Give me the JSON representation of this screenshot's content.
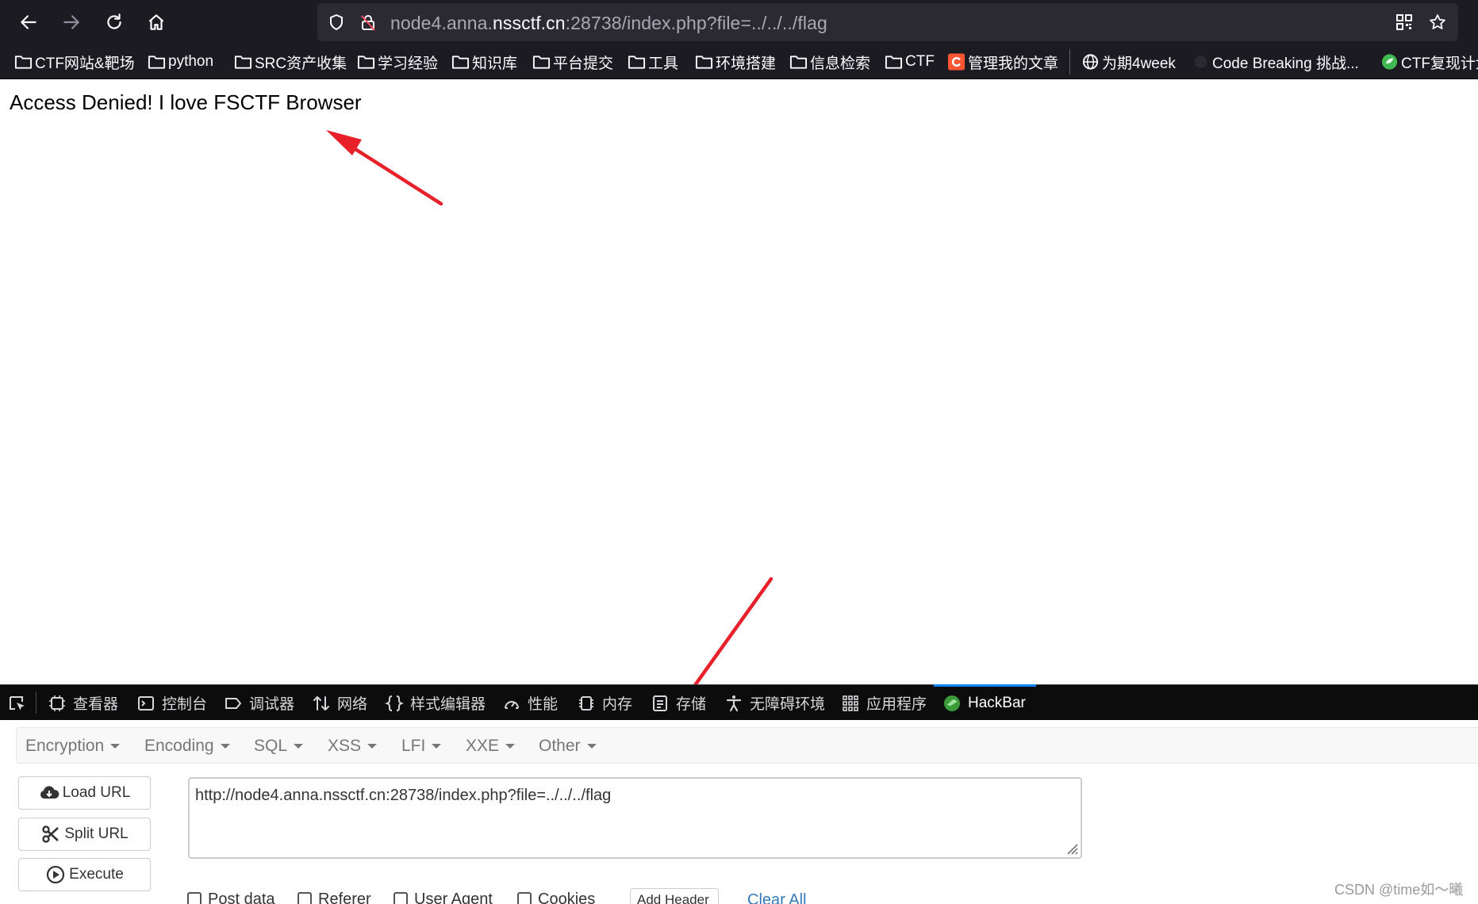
{
  "browser": {
    "url_prefix": "node4.anna.",
    "url_domain": "nssctf.cn",
    "url_suffix": ":28738/index.php?file=../../../flag"
  },
  "bookmarks": [
    {
      "label": "CTF网站&靶场",
      "icon": "folder-icon"
    },
    {
      "label": "python",
      "icon": "folder-icon"
    },
    {
      "label": "SRC资产收集",
      "icon": "folder-icon"
    },
    {
      "label": "学习经验",
      "icon": "folder-icon"
    },
    {
      "label": "知识库",
      "icon": "folder-icon"
    },
    {
      "label": "平台提交",
      "icon": "folder-icon"
    },
    {
      "label": "工具",
      "icon": "folder-icon"
    },
    {
      "label": "环境搭建",
      "icon": "folder-icon"
    },
    {
      "label": "信息检索",
      "icon": "folder-icon"
    },
    {
      "label": "CTF",
      "icon": "folder-icon"
    },
    {
      "label": "管理我的文章",
      "icon": "csdn-logo-icon"
    },
    {
      "label": "为期4week",
      "icon": "globe-icon"
    },
    {
      "label": "Code Breaking 挑战...",
      "icon": "site-icon"
    },
    {
      "label": "CTF复现计划",
      "icon": "green-site-icon"
    }
  ],
  "page": {
    "message": "Access Denied! I love FSCTF Browser"
  },
  "devtools": {
    "tabs": [
      {
        "label": "查看器",
        "icon": "inspector-icon"
      },
      {
        "label": "控制台",
        "icon": "console-icon"
      },
      {
        "label": "调试器",
        "icon": "debugger-icon"
      },
      {
        "label": "网络",
        "icon": "network-icon"
      },
      {
        "label": "样式编辑器",
        "icon": "style-editor-icon"
      },
      {
        "label": "性能",
        "icon": "performance-icon"
      },
      {
        "label": "内存",
        "icon": "memory-icon"
      },
      {
        "label": "存储",
        "icon": "storage-icon"
      },
      {
        "label": "无障碍环境",
        "icon": "accessibility-icon"
      },
      {
        "label": "应用程序",
        "icon": "application-icon"
      },
      {
        "label": "HackBar",
        "icon": "hackbar-icon",
        "active": true
      }
    ]
  },
  "hackbar": {
    "menu": [
      "Encryption",
      "Encoding",
      "SQL",
      "XSS",
      "LFI",
      "XXE",
      "Other"
    ],
    "load_url": "Load URL",
    "split_url": "Split URL",
    "execute": "Execute",
    "url_value": "http://node4.anna.nssctf.cn:28738/index.php?file=../../../flag",
    "options": [
      "Post data",
      "Referer",
      "User Agent",
      "Cookies"
    ],
    "add_header": "Add Header",
    "clear_all": "Clear All"
  },
  "watermark": "CSDN @time如～曦",
  "colors": {
    "toolbar_bg": "#1c1b22",
    "urlbar_bg": "#2b2a33",
    "devtools_bg": "#0c0c0d",
    "active_tab_accent": "#0a84ff",
    "annotation_arrow": "#e8202a",
    "link": "#337ab7"
  }
}
